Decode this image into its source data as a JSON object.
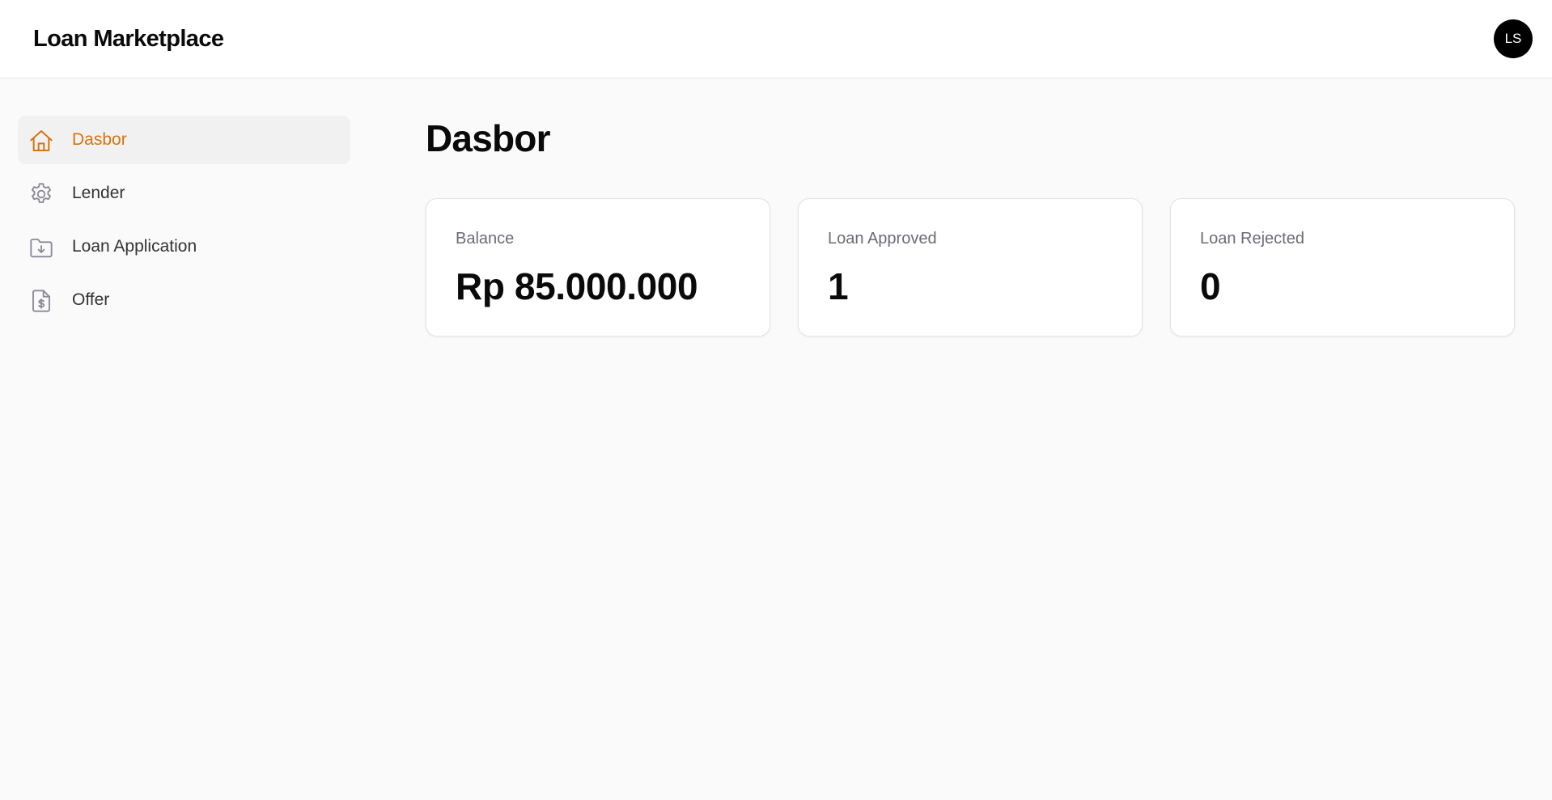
{
  "header": {
    "app_title": "Loan Marketplace",
    "avatar_initials": "LS"
  },
  "sidebar": {
    "items": [
      {
        "label": "Dasbor",
        "icon": "home-icon",
        "active": true
      },
      {
        "label": "Lender",
        "icon": "gear-icon",
        "active": false
      },
      {
        "label": "Loan Application",
        "icon": "folder-download-icon",
        "active": false
      },
      {
        "label": "Offer",
        "icon": "file-dollar-icon",
        "active": false
      }
    ]
  },
  "main": {
    "title": "Dasbor",
    "cards": [
      {
        "label": "Balance",
        "value": "Rp 85.000.000"
      },
      {
        "label": "Loan Approved",
        "value": "1"
      },
      {
        "label": "Loan Rejected",
        "value": "0"
      }
    ]
  },
  "colors": {
    "accent": "#d9730d",
    "background": "#fafafa",
    "surface": "#ffffff",
    "avatar_bg": "#000000",
    "muted_text": "#6b6b78"
  }
}
